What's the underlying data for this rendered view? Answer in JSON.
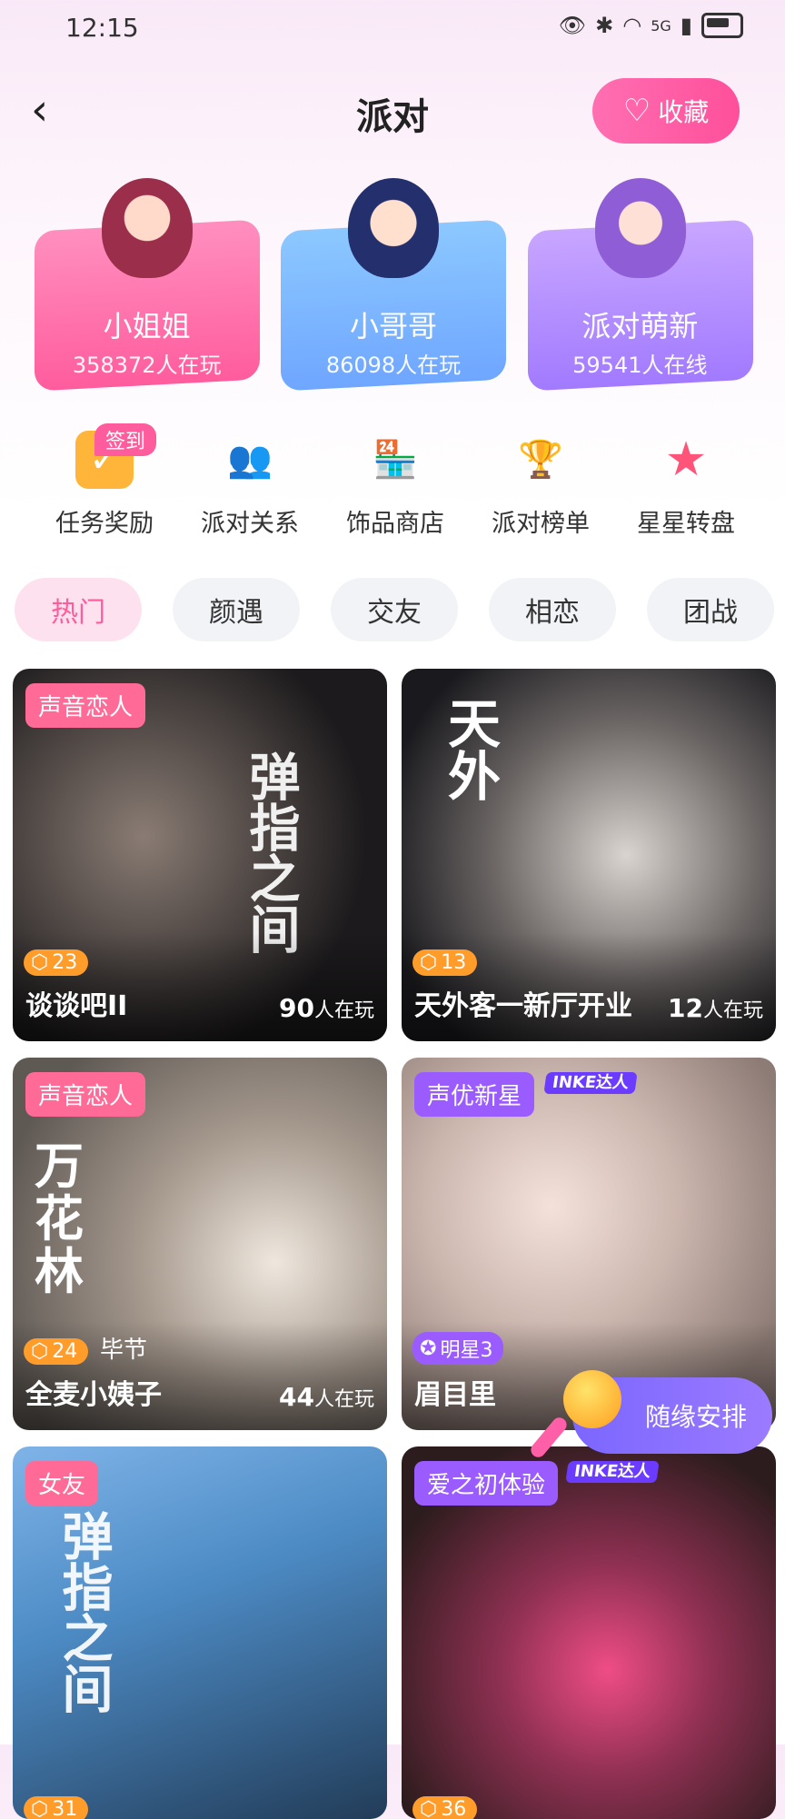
{
  "status": {
    "time": "12:15",
    "signal_label": "5G"
  },
  "nav": {
    "title": "派对",
    "favorite_label": "收藏"
  },
  "room_types": [
    {
      "name": "小姐姐",
      "count": "358372人在玩"
    },
    {
      "name": "小哥哥",
      "count": "86098人在玩"
    },
    {
      "name": "派对萌新",
      "count": "59541人在线"
    }
  ],
  "quick_actions": [
    {
      "label": "任务奖励",
      "badge": "签到",
      "icon": "calendar-check-icon"
    },
    {
      "label": "派对关系",
      "icon": "people-icon"
    },
    {
      "label": "饰品商店",
      "icon": "shop-icon"
    },
    {
      "label": "派对榜单",
      "icon": "trophy-icon"
    },
    {
      "label": "星星转盘",
      "icon": "star-icon"
    }
  ],
  "tabs": [
    "热门",
    "颜遇",
    "交友",
    "相恋",
    "团战"
  ],
  "rooms": [
    {
      "tag": "声音恋人",
      "level": "23",
      "name": "谈谈吧II",
      "online_num": "90",
      "online_unit": "人在玩",
      "deco": "弹指之间"
    },
    {
      "tag": "",
      "level": "13",
      "name": "天外客一新厅开业",
      "online_num": "12",
      "online_unit": "人在玩",
      "deco": "天外"
    },
    {
      "tag": "声音恋人",
      "level": "24",
      "location": "毕节",
      "name": "全麦小姨子",
      "online_num": "44",
      "online_unit": "人在玩",
      "deco": "万花林"
    },
    {
      "tag": "声优新星",
      "inke": "INKE达人",
      "star_level": "明星3",
      "name": "眉目里"
    },
    {
      "tag": "女友",
      "level": "31",
      "deco": "弹指之间"
    },
    {
      "tag": "爱之初体验",
      "inke": "INKE达人",
      "level": "36"
    }
  ],
  "floating": {
    "random_label": "随缘安排"
  },
  "colors": {
    "accent": "#ff5c9d",
    "purple": "#7b66ff",
    "level_badge": "#ff9c2a"
  }
}
